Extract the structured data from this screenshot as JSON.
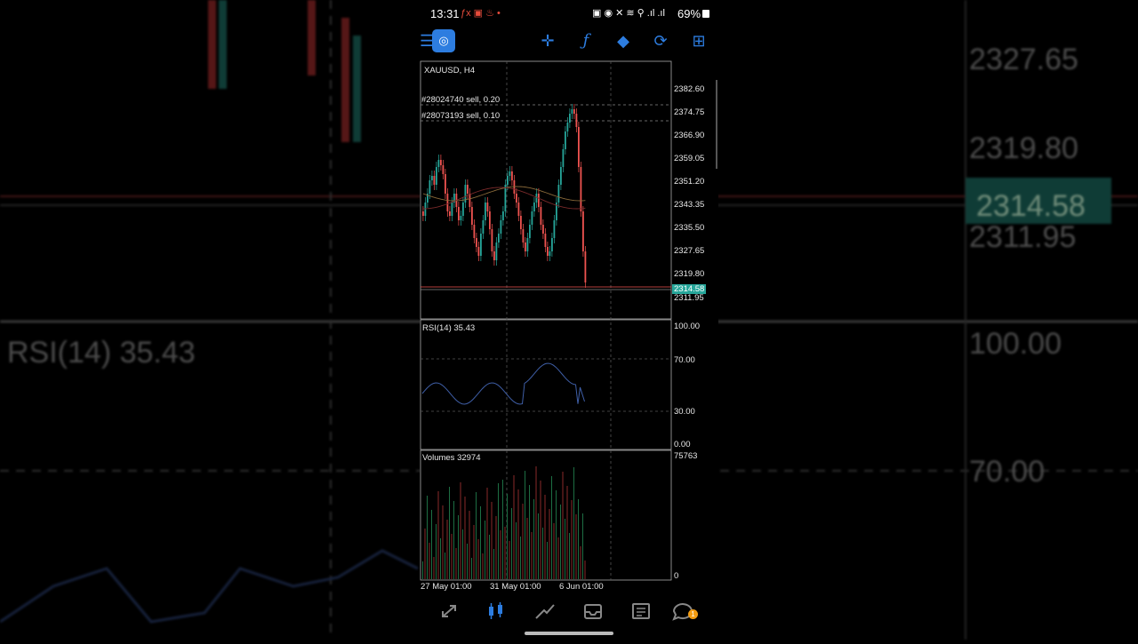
{
  "status_bar": {
    "time": "13:31",
    "battery": "69%"
  },
  "chart": {
    "symbol": "XAUUSD, H4",
    "orders": [
      "#28024740 sell, 0.20",
      "#28073193 sell, 0.10"
    ],
    "price_levels": [
      "2382.60",
      "2374.75",
      "2366.90",
      "2359.05",
      "2351.20",
      "2343.35",
      "2335.50",
      "2327.65",
      "2319.80",
      "2311.95"
    ],
    "current_price": "2314.58",
    "rsi_label": "RSI(14) 35.43",
    "rsi_levels": [
      "100.00",
      "70.00",
      "30.00",
      "0.00"
    ],
    "volume_label": "Volumes 32974",
    "volume_levels": [
      "75763",
      "0"
    ],
    "dates": [
      "27 May 01:00",
      "31 May 01:00",
      "6 Jun 01:00"
    ]
  },
  "background": {
    "prices": [
      "2327.65",
      "2319.80",
      "2314.58",
      "2311.95",
      "100.00",
      "70.00"
    ],
    "rsi_label": "RSI(14) 35.43"
  },
  "colors": {
    "bull": "#26a69a",
    "bear": "#ef5350",
    "accent": "#2d7de0",
    "badge": "#f39c12"
  },
  "icons": [
    "crosshair-icon",
    "indicator-icon",
    "objects-icon",
    "timeframe-icon",
    "add-template-icon",
    "menu-icon",
    "app-logo-icon",
    "quotes-icon",
    "chart-icon",
    "trade-icon",
    "history-icon",
    "news-icon",
    "messages-icon"
  ],
  "messages_badge": "1"
}
